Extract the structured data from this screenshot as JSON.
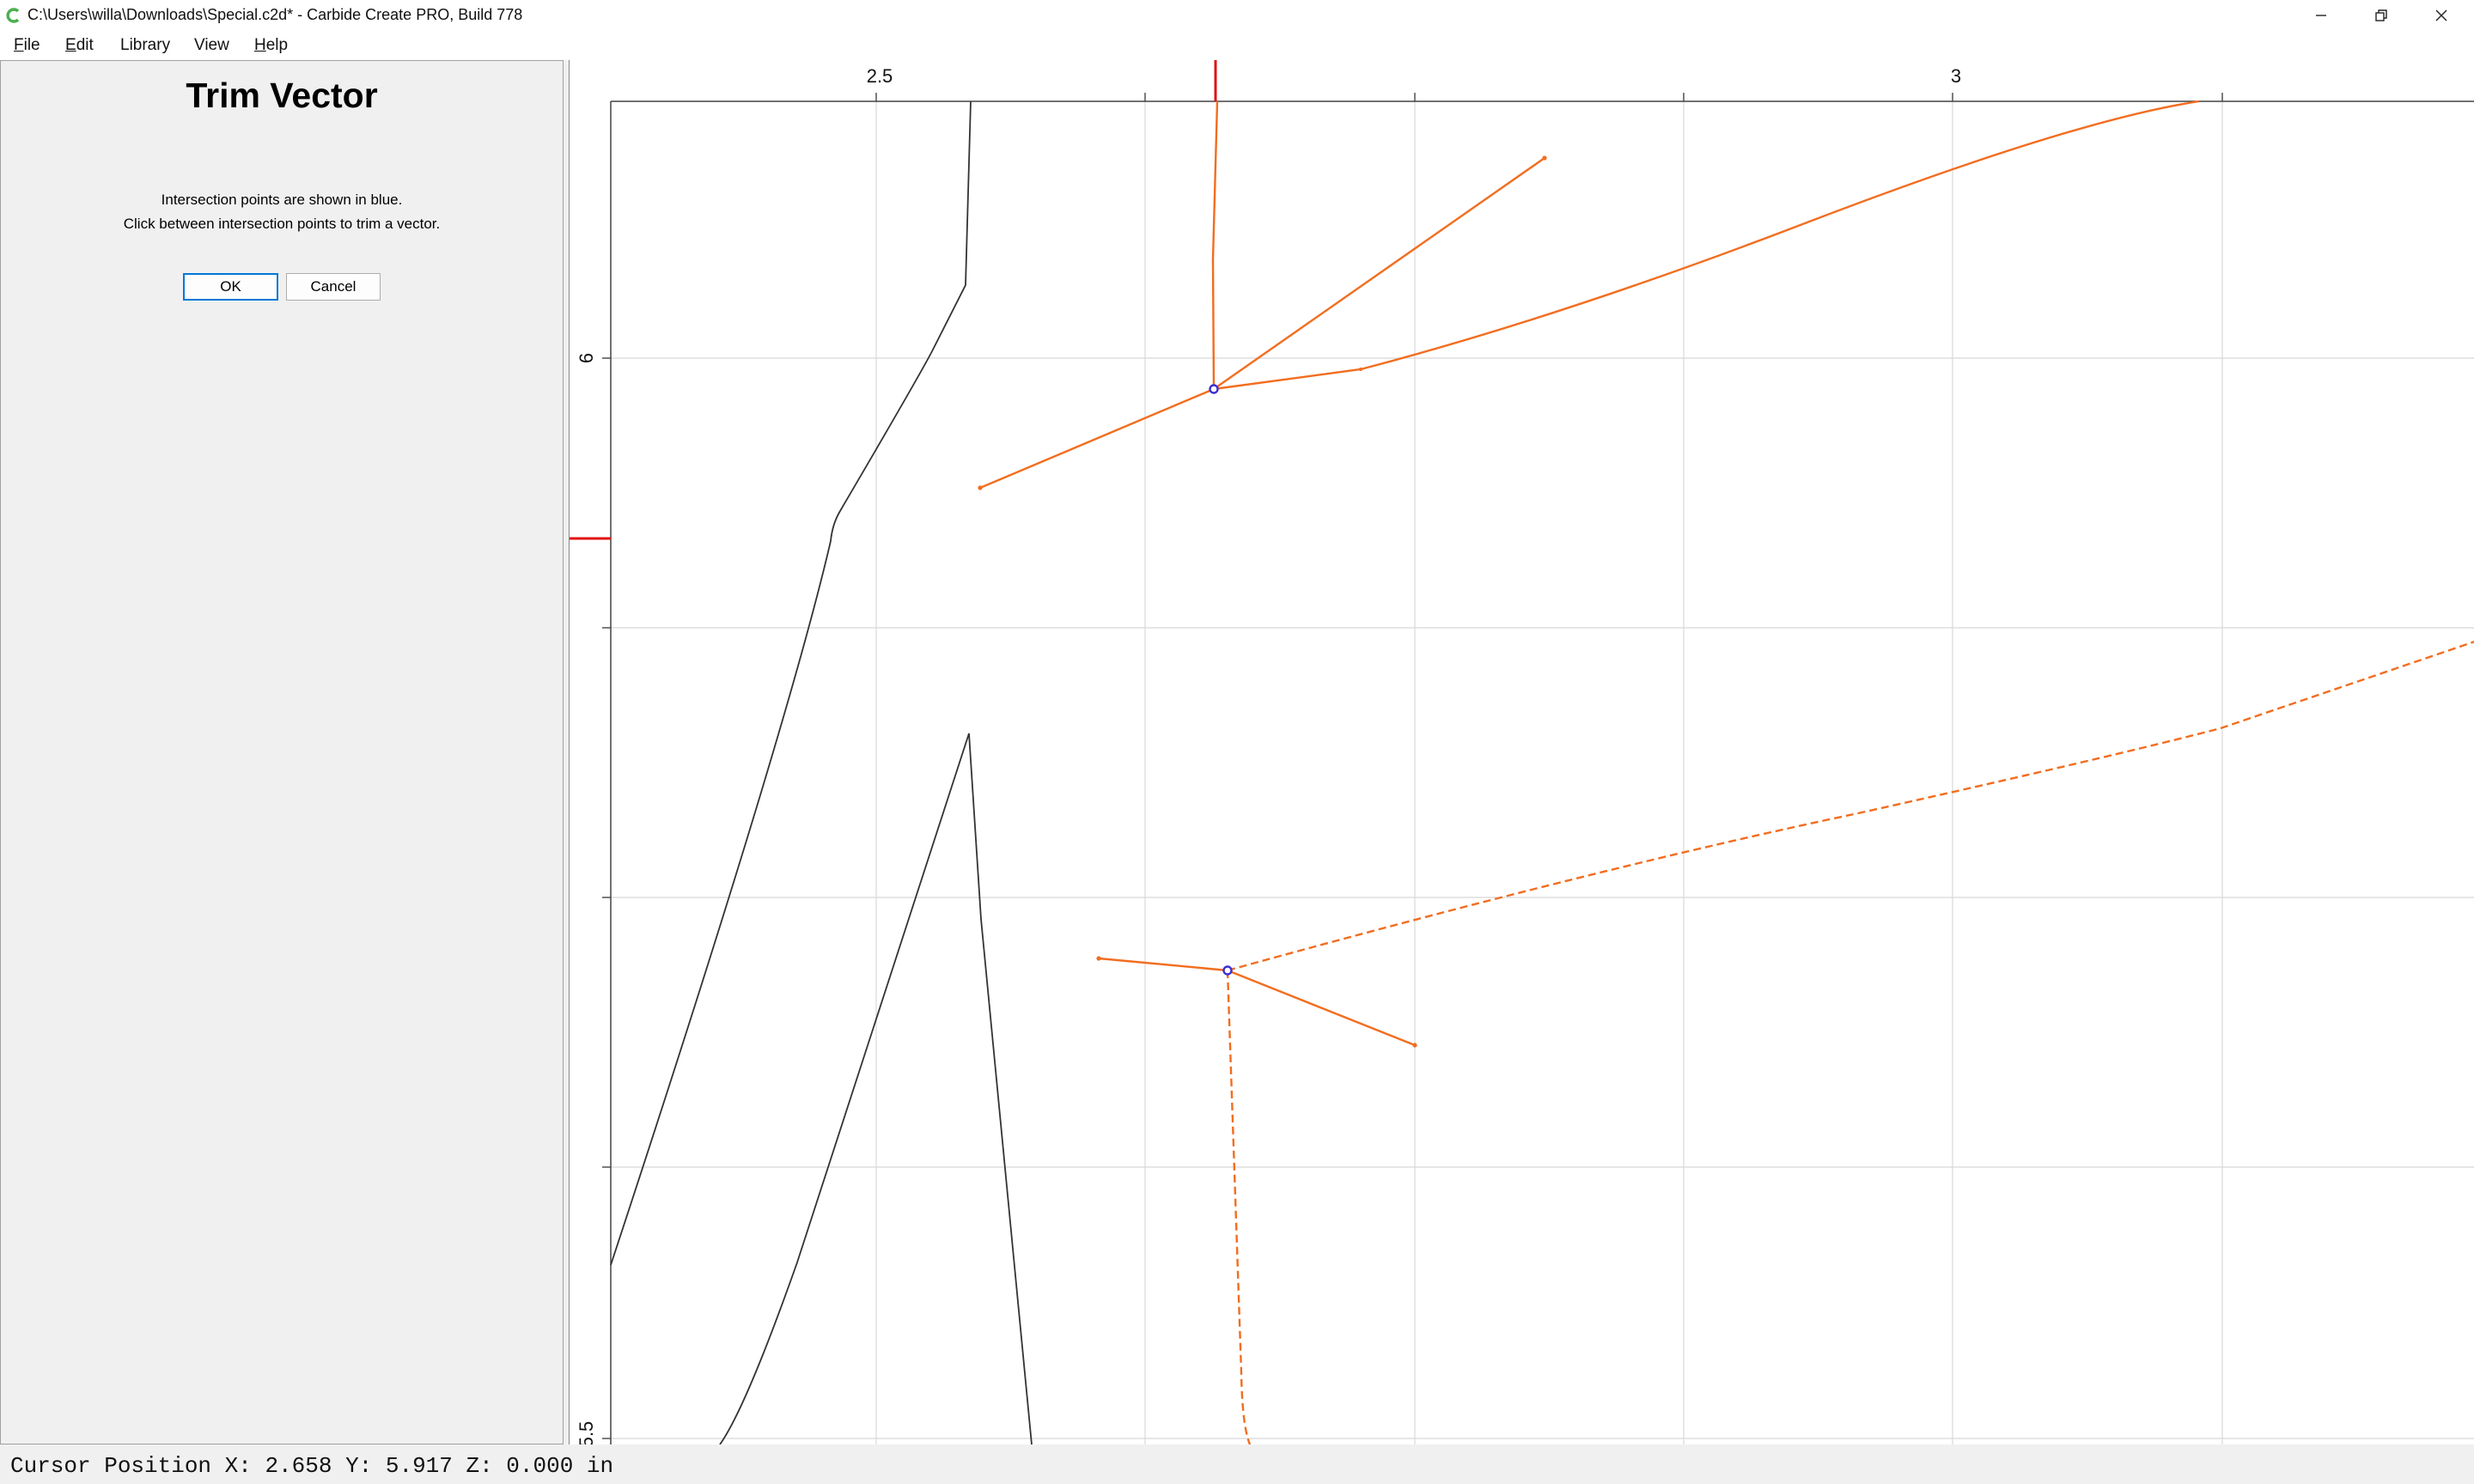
{
  "window": {
    "title": "C:\\Users\\willa\\Downloads\\Special.c2d* - Carbide Create PRO, Build 778",
    "icon": "carbide-logo-icon",
    "accent_color": "#4caf50",
    "controls": [
      "minimize-icon",
      "restore-icon",
      "close-icon"
    ]
  },
  "menu": {
    "items": [
      {
        "label": "File",
        "mnemonic": "F",
        "rest": "ile"
      },
      {
        "label": "Edit",
        "mnemonic": "E",
        "rest": "dit"
      },
      {
        "label": "Library",
        "mnemonic": "",
        "rest": "Library"
      },
      {
        "label": "View",
        "mnemonic": "",
        "rest": "View"
      },
      {
        "label": "Help",
        "mnemonic": "H",
        "rest": "elp"
      }
    ]
  },
  "panel": {
    "title": "Trim Vector",
    "message_line1": "Intersection points are shown in blue.",
    "message_line2": "Click between intersection points to trim a vector.",
    "ok_label": "OK",
    "cancel_label": "Cancel"
  },
  "canvas": {
    "x_ruler_labels": [
      "2.5",
      "3"
    ],
    "y_ruler_labels": [
      "6",
      "5.5"
    ],
    "colors": {
      "vector": "#f26d1f",
      "intersection": "#3a2fd4",
      "cursor_marker": "#e01010",
      "geometry": "#333333",
      "grid": "#d8d8d8"
    }
  },
  "status": {
    "text": "Cursor Position X: 2.658 Y: 5.917 Z: 0.000 in"
  }
}
